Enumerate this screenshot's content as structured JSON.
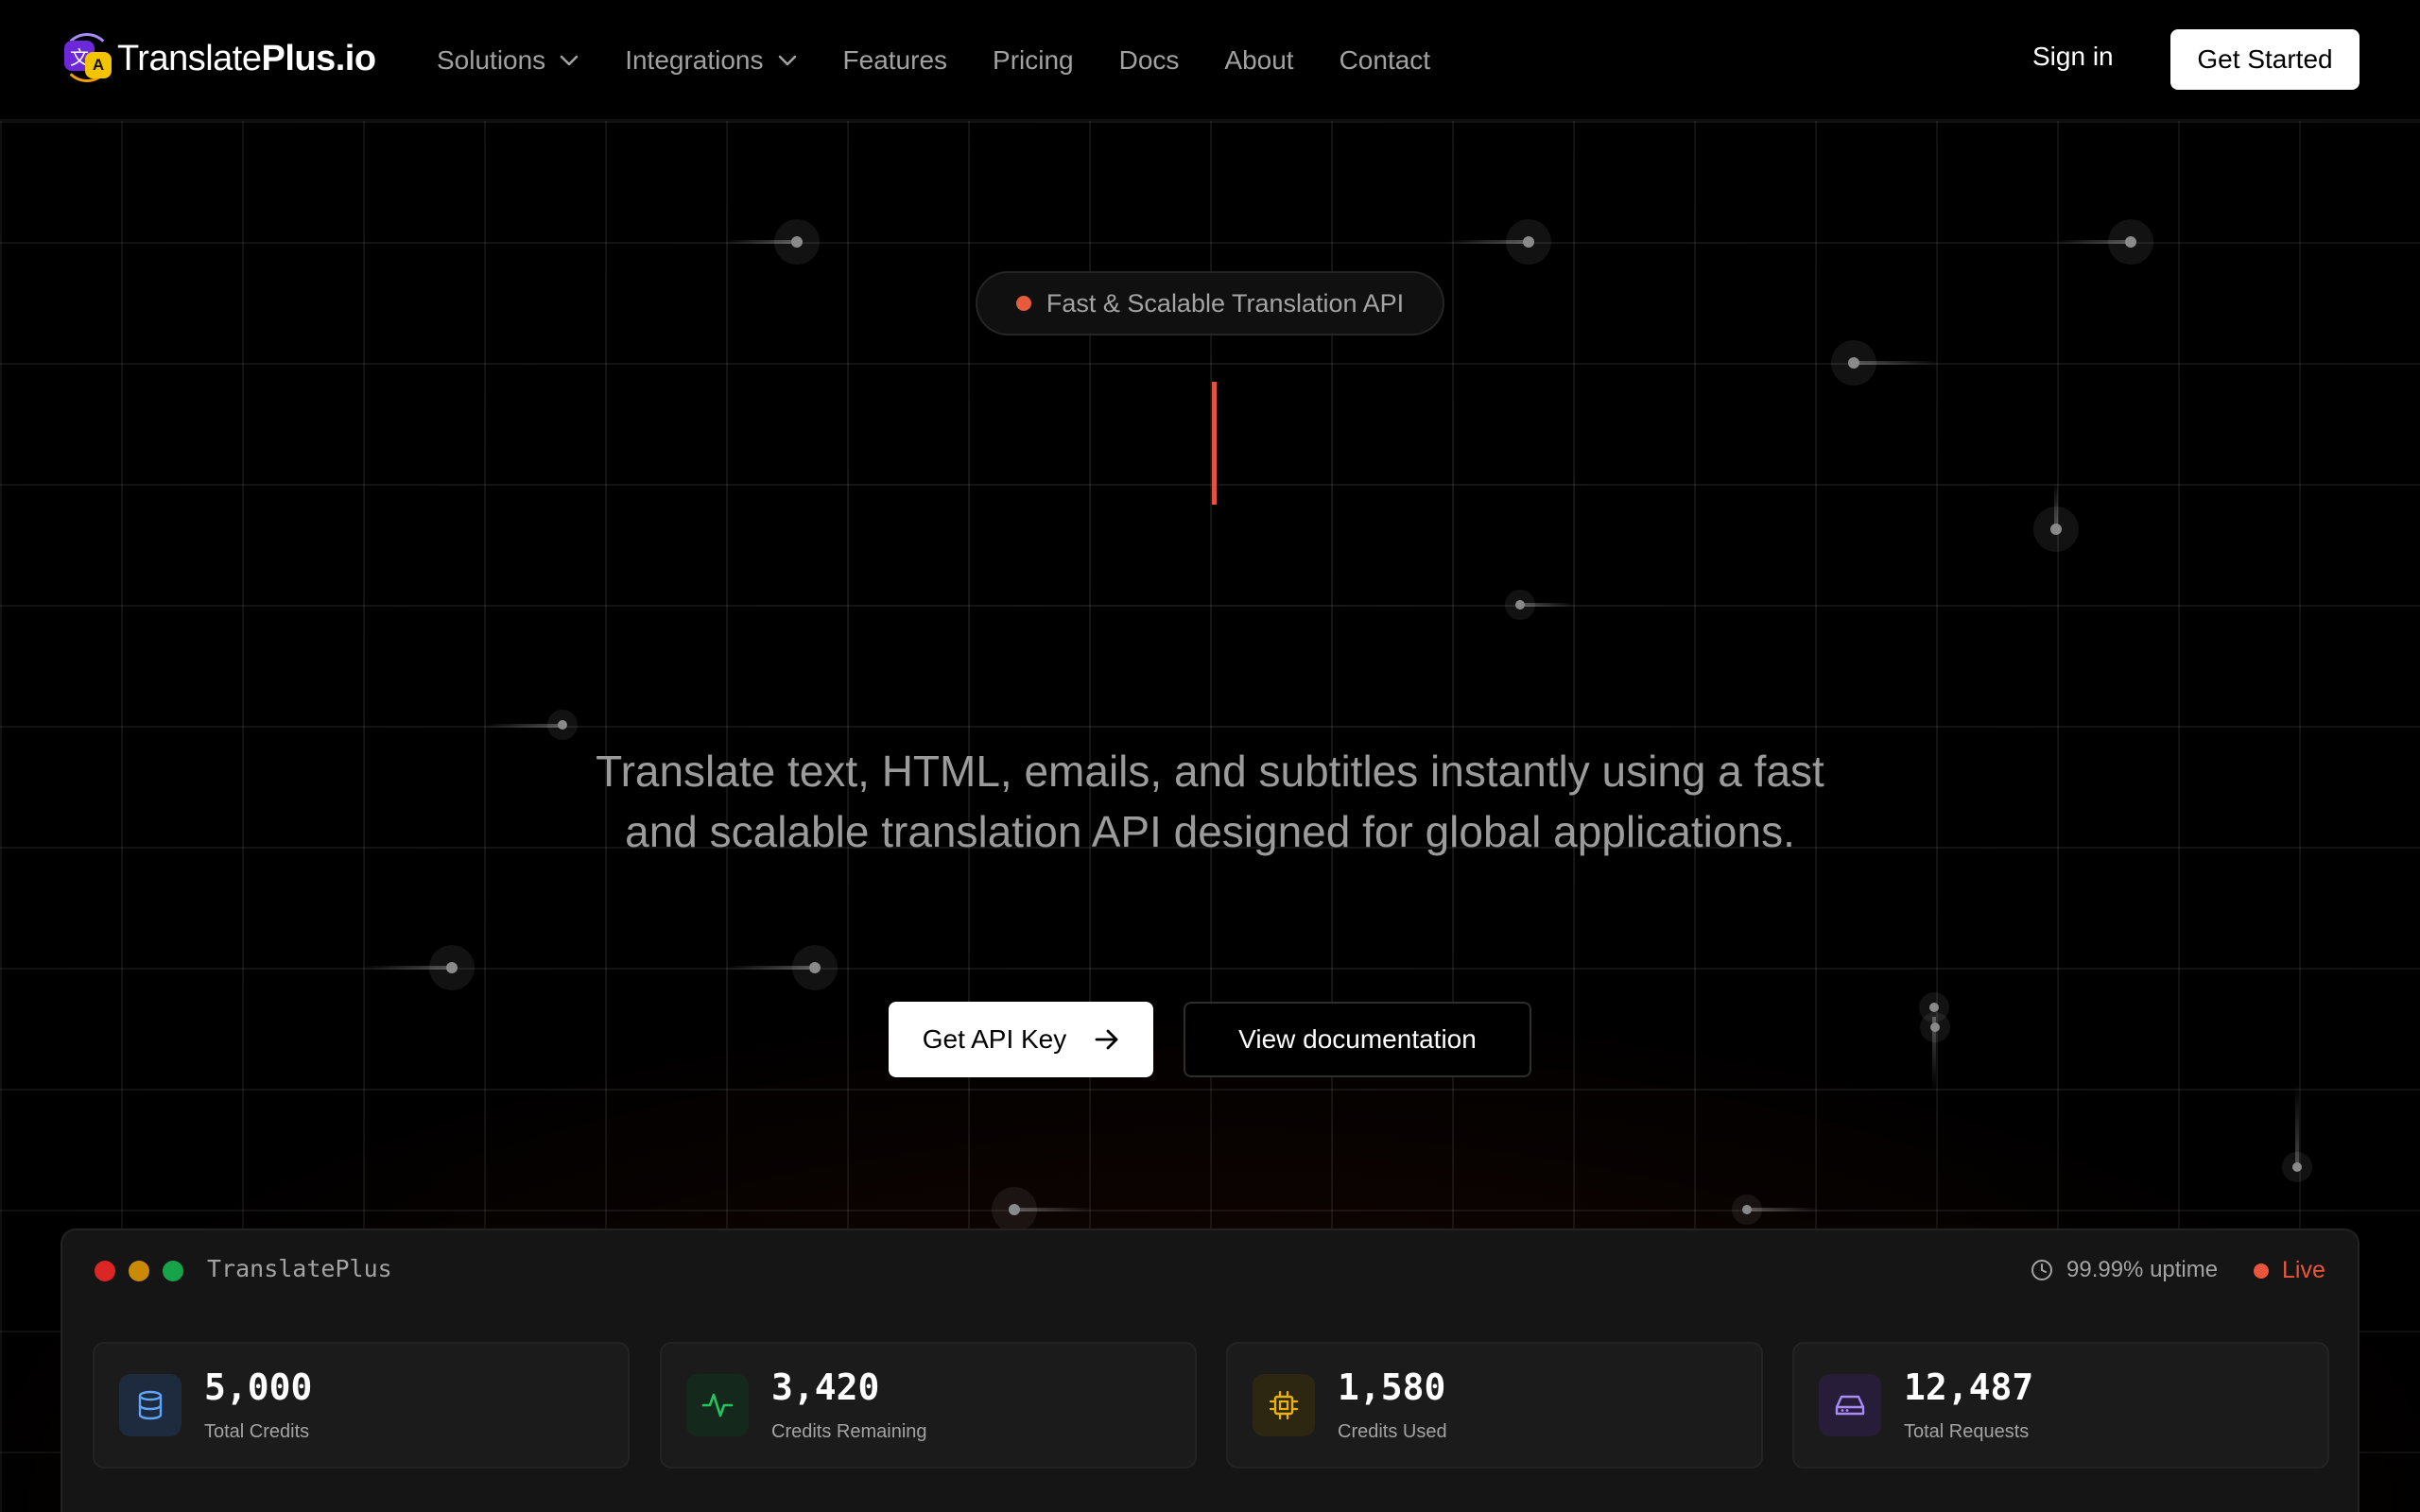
{
  "nav": {
    "logo_main": "Translate",
    "logo_bold": "Plus.io",
    "links": [
      {
        "label": "Solutions",
        "dropdown": true
      },
      {
        "label": "Integrations",
        "dropdown": true
      },
      {
        "label": "Features"
      },
      {
        "label": "Pricing"
      },
      {
        "label": "Docs"
      },
      {
        "label": "About"
      },
      {
        "label": "Contact"
      }
    ],
    "signin_label": "Sign in",
    "get_started_label": "Get Started"
  },
  "hero": {
    "badge": "Fast & Scalable Translation API",
    "subtitle": "Translate text, HTML, emails, and subtitles instantly using a fast and scalable translation API designed for global applications.",
    "primary_cta": "Get API Key",
    "secondary_cta": "View documentation"
  },
  "dashboard": {
    "title": "TranslatePlus",
    "uptime": "99.99% uptime",
    "status": "Live",
    "stats": [
      {
        "value": "5,000",
        "label": "Total Credits",
        "icon": "database-icon",
        "color": "#60a5fa"
      },
      {
        "value": "3,420",
        "label": "Credits Remaining",
        "icon": "activity-icon",
        "color": "#22c55e"
      },
      {
        "value": "1,580",
        "label": "Credits Used",
        "icon": "cpu-icon",
        "color": "#eab308"
      },
      {
        "value": "12,487",
        "label": "Total Requests",
        "icon": "hard-drive-icon",
        "color": "#a78bfa"
      }
    ]
  },
  "colors": {
    "accent": "#e8553a",
    "background": "#000000",
    "panel": "#151515"
  }
}
